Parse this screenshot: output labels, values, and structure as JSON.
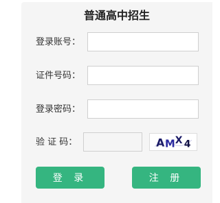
{
  "form": {
    "title": "普通高中招生",
    "account_label": "登录账号：",
    "account_value": "",
    "id_label": "证件号码：",
    "id_value": "",
    "password_label": "登录密码：",
    "password_value": "",
    "captcha_label": "验 证 码：",
    "captcha_value": "",
    "captcha_text": "AMX4"
  },
  "buttons": {
    "login_label": "登 录",
    "register_label": "注 册"
  },
  "colors": {
    "button": "#35b580",
    "panel": "#f5f5f5",
    "border": "#cfcfcf"
  }
}
